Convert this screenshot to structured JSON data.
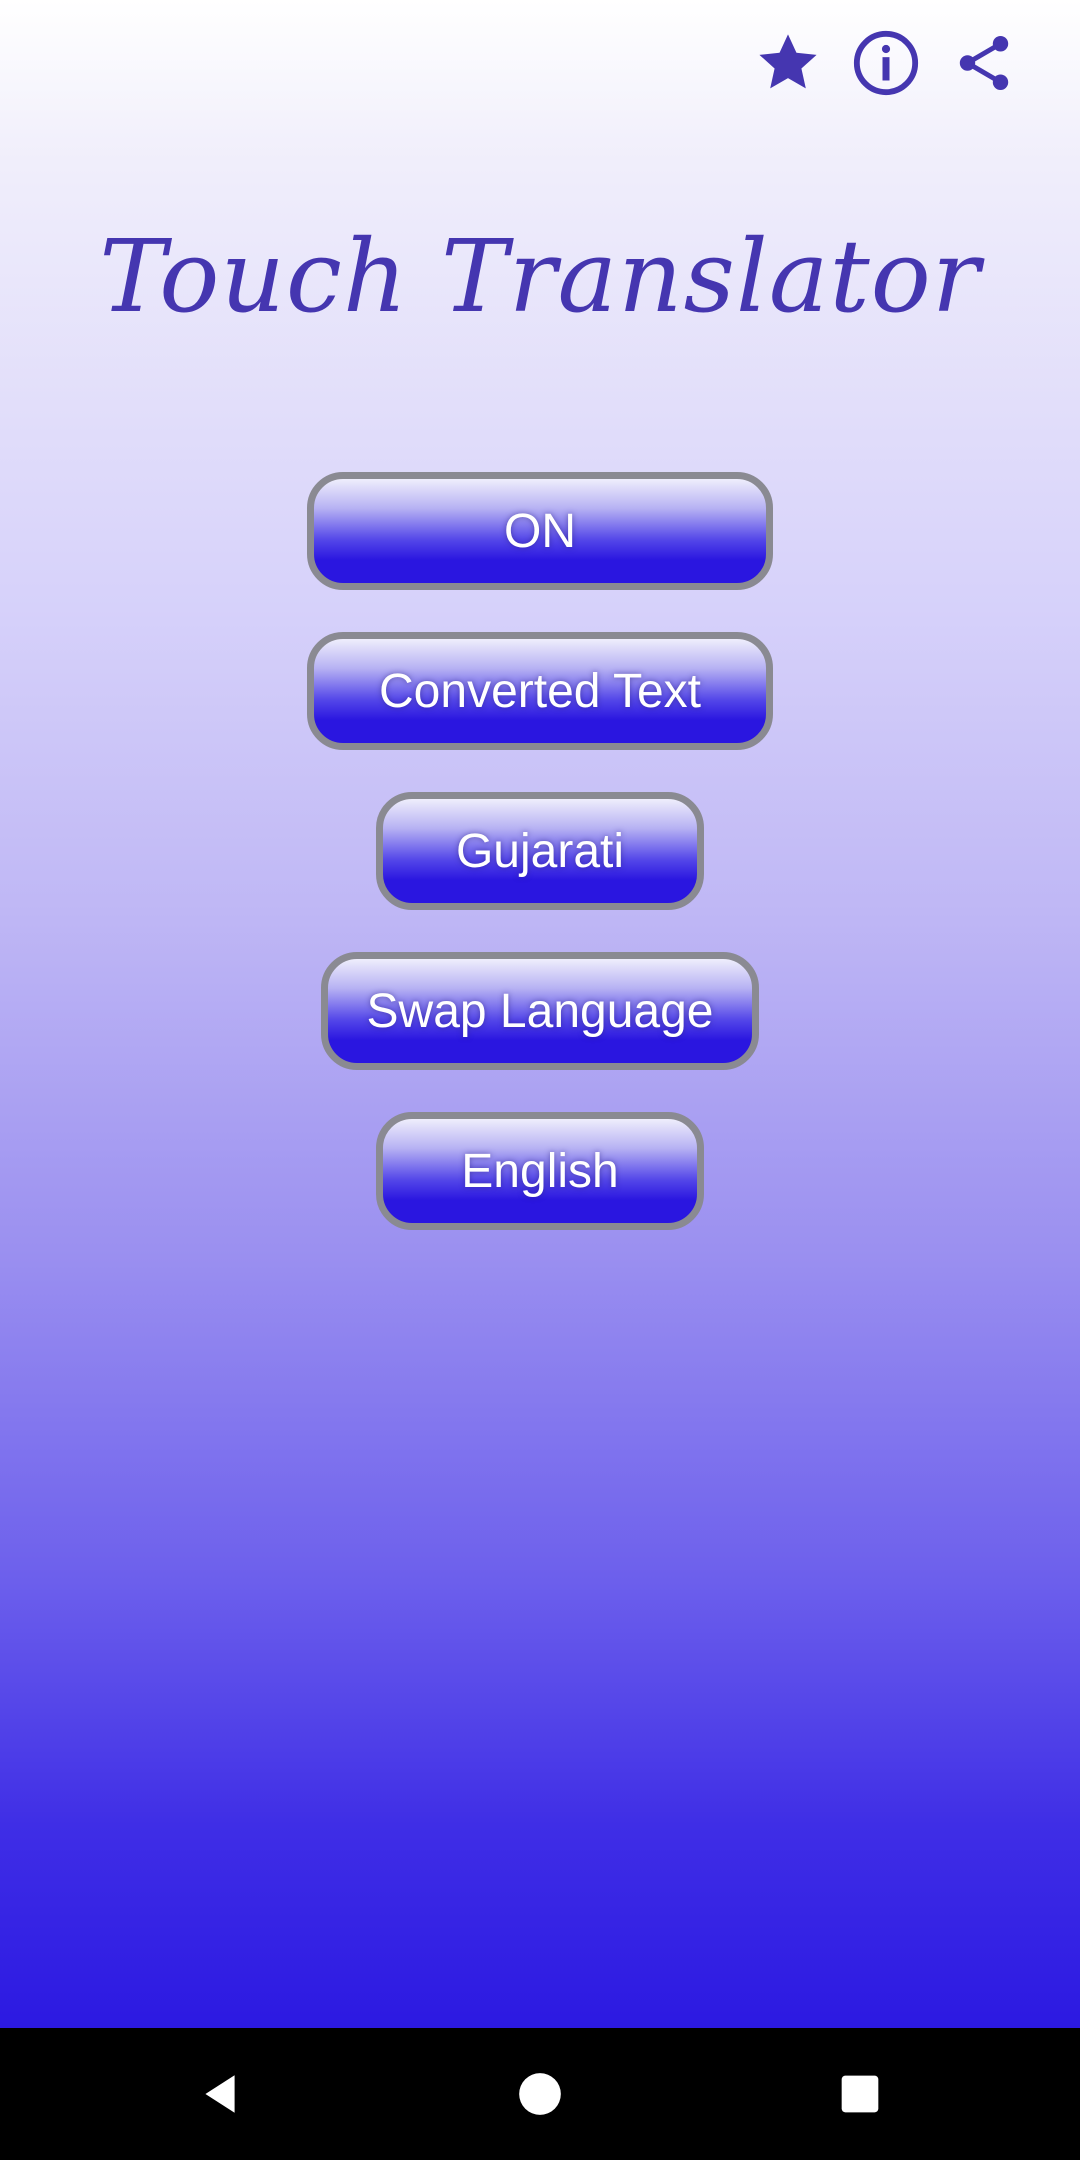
{
  "app": {
    "title": "Touch Translator"
  },
  "top_actions": [
    {
      "name": "star-icon"
    },
    {
      "name": "info-icon"
    },
    {
      "name": "share-icon"
    }
  ],
  "buttons": {
    "on_label": "ON",
    "converted_label": "Converted Text",
    "source_language_label": "Gujarati",
    "swap_label": "Swap Language",
    "target_language_label": "English"
  },
  "colors": {
    "accent": "#4536b0",
    "button_top": "#efeefc",
    "button_bottom": "#2a16e0",
    "button_border": "#8a8a92",
    "background_bottom": "#2c19e2"
  },
  "nav": {
    "back": "back-icon",
    "home": "home-icon",
    "recents": "recents-icon"
  }
}
